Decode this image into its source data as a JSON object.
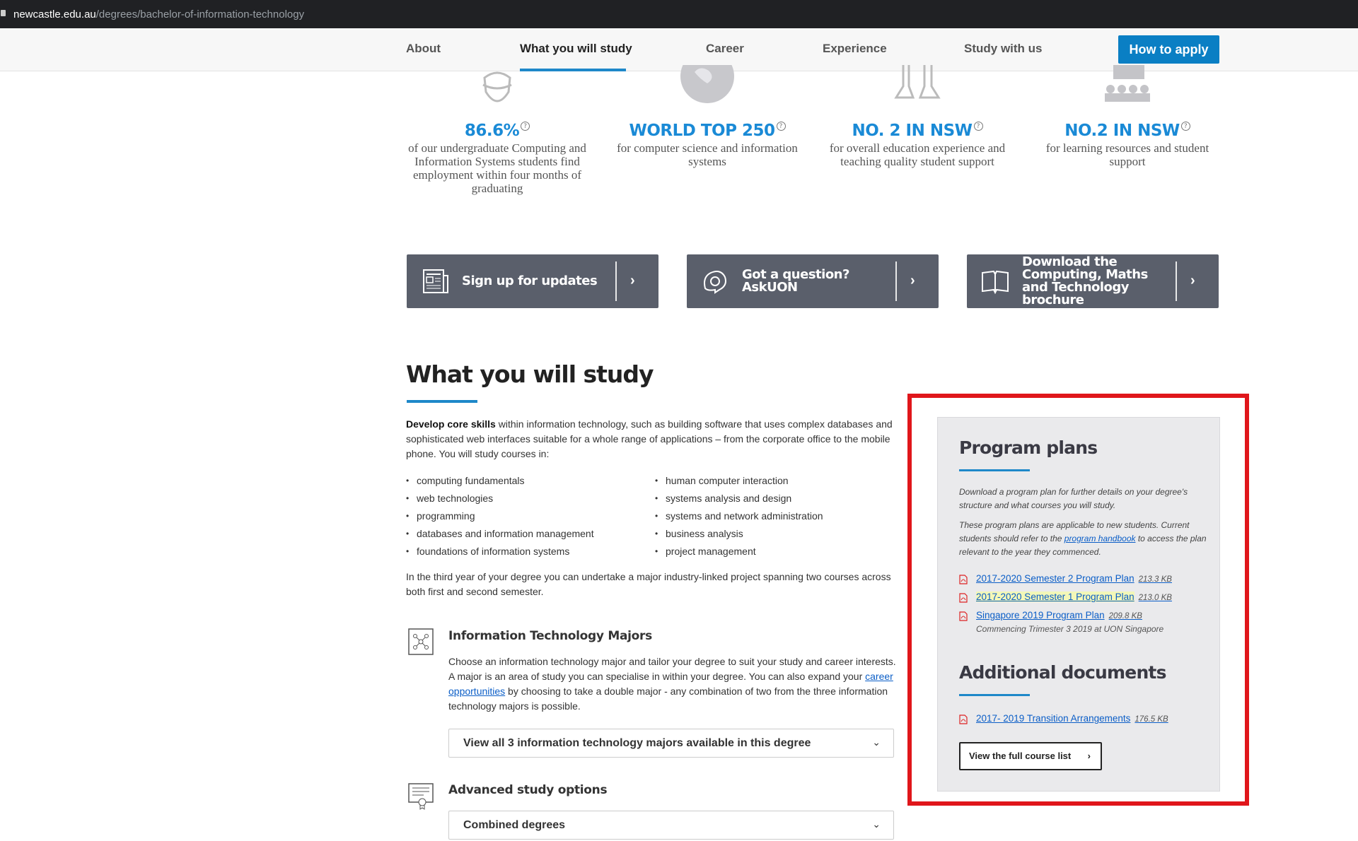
{
  "browser": {
    "url_host": "newcastle.edu.au",
    "url_path": "/degrees/bachelor-of-information-technology"
  },
  "nav": {
    "items": [
      "About",
      "What you will study",
      "Career",
      "Experience",
      "Study with us"
    ],
    "active": "What you will study",
    "apply": "How to apply",
    "accent": "#1e88c9"
  },
  "stats": [
    {
      "value": "86.6%",
      "desc": "of our undergraduate Computing and Information Systems students find employment within four months of graduating",
      "icon": "graduate-icon"
    },
    {
      "value": "WORLD TOP 250",
      "desc": "for computer science and information systems",
      "icon": "globe-icon"
    },
    {
      "value": "NO. 2 IN NSW",
      "desc": "for overall education experience and teaching quality student support",
      "icon": "people-icon"
    },
    {
      "value": "NO.2 IN NSW",
      "desc": "for learning resources and student support",
      "icon": "classroom-icon"
    }
  ],
  "ctas": [
    {
      "label": "Sign up for updates",
      "icon": "newspaper-icon"
    },
    {
      "label": "Got a question? AskUON",
      "icon": "chat-icon"
    },
    {
      "label": "Download the Computing, Maths and Technology brochure",
      "icon": "book-icon"
    }
  ],
  "study": {
    "title": "What you will study",
    "intro_bold": "Develop core skills",
    "intro_rest": " within information technology, such as building software that uses complex databases and sophisticated web interfaces suitable for a whole range of applications – from the corporate office to the mobile phone. You will study courses in:",
    "courses_left": [
      "computing fundamentals",
      "web technologies",
      "programming",
      "databases and information management",
      "foundations of information systems"
    ],
    "courses_right": [
      "human computer interaction",
      "systems analysis and design",
      "systems and network administration",
      "business analysis",
      "project management"
    ],
    "para2": "In the third year of your degree you can undertake a major industry-linked project spanning two courses across both first and second semester."
  },
  "majors": {
    "title": "Information Technology Majors",
    "text_before": "Choose an information technology major and tailor your degree to suit your study and career interests. A major is an area of study you can specialise in within your degree. You can also expand your ",
    "link": "career opportunities",
    "text_after": " by choosing to take a double major - any combination of two from the three information technology majors is possible.",
    "dropdown": "View all 3 information technology majors available in this degree"
  },
  "advanced": {
    "title": "Advanced study options",
    "dropdown": "Combined degrees"
  },
  "sidebar": {
    "title": "Program plans",
    "p1": "Download a program plan for further details on your degree's structure and what courses you will study.",
    "p2_before": "These program plans are applicable to new students. Current students should refer to the ",
    "p2_link": "program handbook",
    "p2_after": " to access the plan relevant to the year they commenced.",
    "plans": [
      {
        "label": "2017-2020 Semester 2 Program Plan",
        "size": "213.3 KB"
      },
      {
        "label": "2017-2020 Semester 1 Program Plan",
        "size": "213.0 KB"
      },
      {
        "label": "Singapore 2019 Program Plan",
        "size": "209.8 KB",
        "note": "Commencing Trimester 3 2019 at UON Singapore"
      }
    ],
    "additional_title": "Additional documents",
    "additional": [
      {
        "label": "2017- 2019 Transition Arrangements",
        "size": "176.5 KB"
      }
    ],
    "full_list": "View the full course list"
  },
  "highlight_color": "#e0161b"
}
